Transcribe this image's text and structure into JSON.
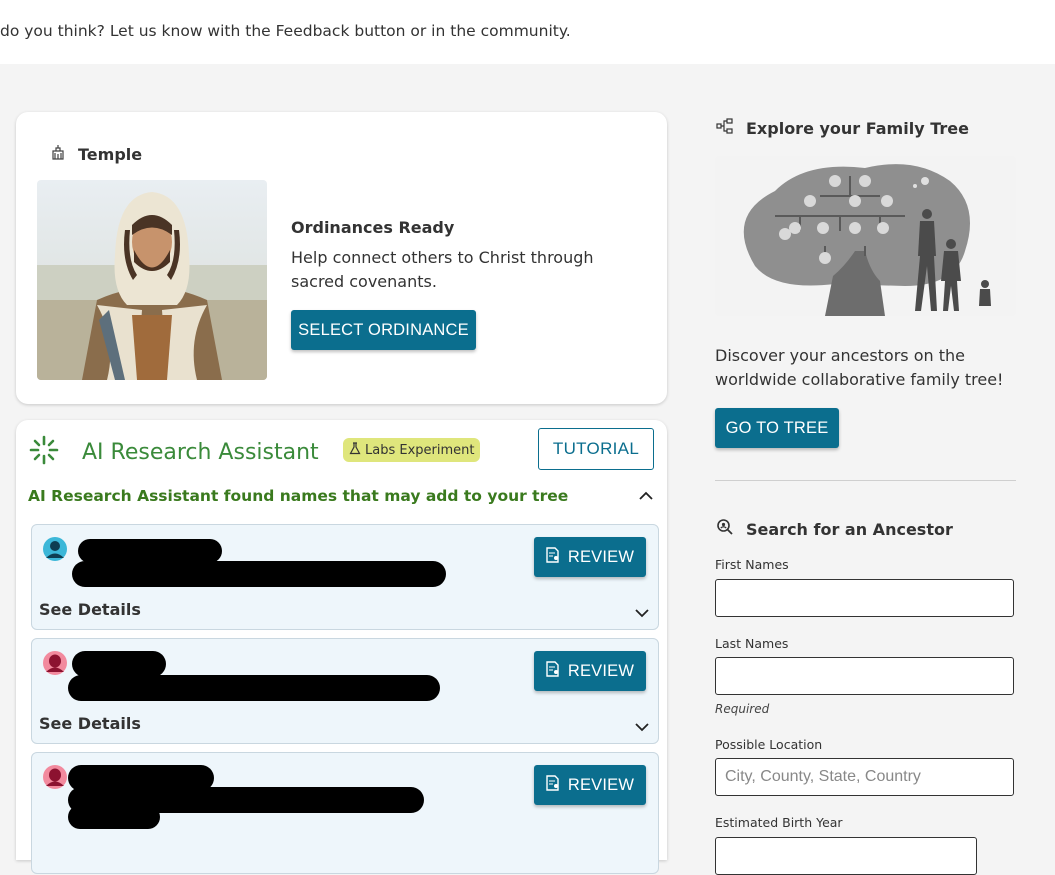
{
  "banner": {
    "text": "do you think? Let us know with the Feedback button or in the community."
  },
  "temple": {
    "title": "Temple",
    "ordinances_title": "Ordinances Ready",
    "description": "Help connect others to Christ through sacred covenants.",
    "button_label": "SELECT ORDINANCE"
  },
  "ai_assistant": {
    "title": "AI Research Assistant",
    "badge": "Labs Experiment",
    "tutorial_label": "TUTORIAL",
    "found_text": "AI Research Assistant found names that may add to your tree",
    "results": [
      {
        "gender": "male",
        "review_label": "REVIEW",
        "details_label": "See Details"
      },
      {
        "gender": "female",
        "review_label": "REVIEW",
        "details_label": "See Details"
      },
      {
        "gender": "female",
        "review_label": "REVIEW"
      }
    ]
  },
  "explore": {
    "title": "Explore your Family Tree",
    "description": "Discover your ancestors on the worldwide collaborative family tree!",
    "button_label": "GO TO TREE"
  },
  "search": {
    "title": "Search for an Ancestor",
    "first_names_label": "First Names",
    "first_names_value": "",
    "last_names_label": "Last Names",
    "last_names_value": "",
    "required_text": "Required",
    "location_label": "Possible Location",
    "location_placeholder": "City, County, State, Country",
    "birth_year_label": "Estimated Birth Year"
  },
  "colors": {
    "primary": "#0b6e8e",
    "ai_green": "#3a8a3a",
    "badge_yellow": "#dfe67c",
    "card_bg": "#eef6fb"
  }
}
